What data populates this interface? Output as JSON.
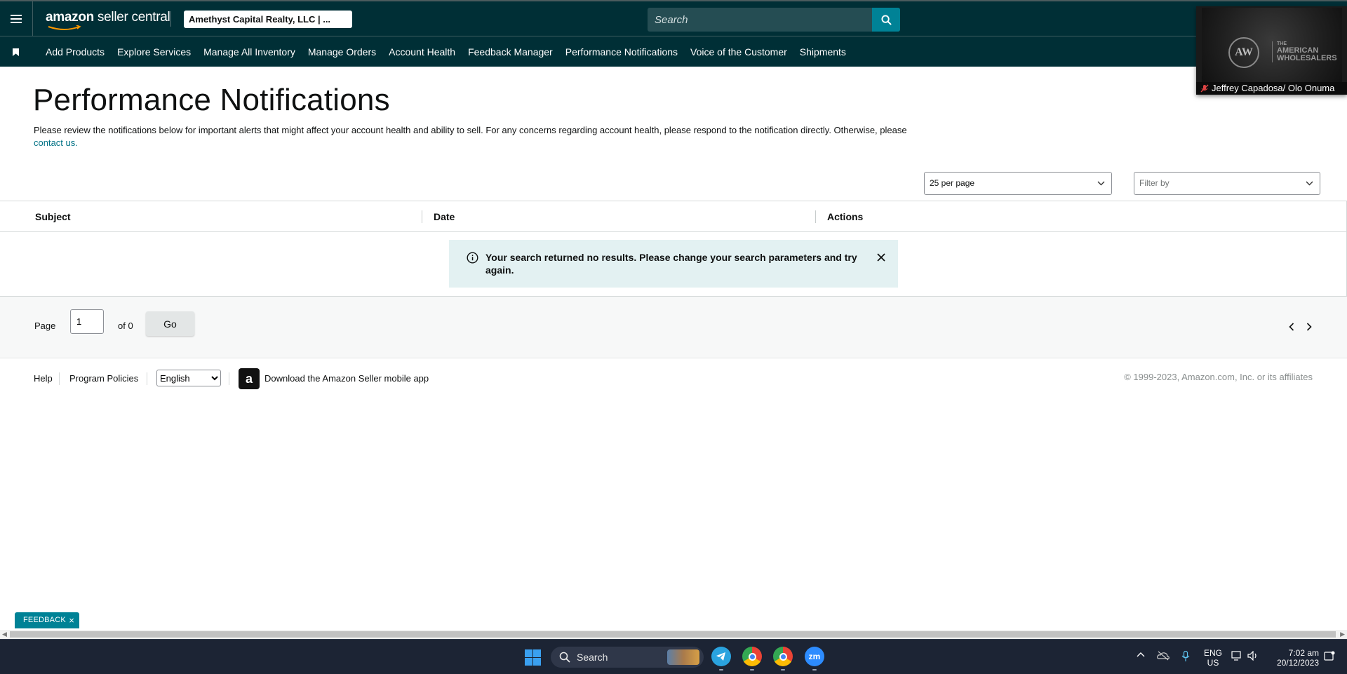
{
  "header": {
    "logo_text_bold": "amazon",
    "logo_text_light": " seller central",
    "account_selector": "Amethyst Capital Realty, LLC | ...",
    "search_placeholder": "Search"
  },
  "nav": {
    "items": [
      {
        "label": "Add Products"
      },
      {
        "label": "Explore Services"
      },
      {
        "label": "Manage All Inventory"
      },
      {
        "label": "Manage Orders"
      },
      {
        "label": "Account Health"
      },
      {
        "label": "Feedback Manager"
      },
      {
        "label": "Performance Notifications"
      },
      {
        "label": "Voice of the Customer"
      },
      {
        "label": "Shipments"
      }
    ]
  },
  "video_overlay": {
    "emblem": "AW",
    "brand_line1": "THE",
    "brand_line2": "AMERICAN",
    "brand_line3": "WHOLESALERS",
    "participant": "Jeffrey Capadosa/ Olo Onuma"
  },
  "page": {
    "title": "Performance Notifications",
    "description": "Please review the notifications below for important alerts that might affect your account health and ability to sell. For any concerns regarding account health, please respond to the notification directly. Otherwise, please ",
    "contact_link": "contact us.",
    "per_page_select": "25 per page",
    "filter_select": "Filter by"
  },
  "table": {
    "columns": [
      "Subject",
      "Date",
      "Actions"
    ],
    "empty_message": "Your search returned no results. Please change your search parameters and try again."
  },
  "pager": {
    "page_label": "Page",
    "page_value": "1",
    "of_label": "of 0",
    "go_label": "Go"
  },
  "footer": {
    "help": "Help",
    "policies": "Program Policies",
    "language": "English",
    "app_icon_letter": "a",
    "app_download": "Download the Amazon Seller mobile app",
    "copyright": "© 1999-2023, Amazon.com, Inc. or its affiliates"
  },
  "feedback": {
    "label": "FEEDBACK",
    "close": "×"
  },
  "taskbar": {
    "search_label": "Search",
    "zoom_label": "zm",
    "lang_line1": "ENG",
    "lang_line2": "US",
    "time": "7:02 am",
    "date": "20/12/2023"
  },
  "colors": {
    "header_bg": "#002f36",
    "accent_teal": "#008296",
    "link": "#007185",
    "alert_bg": "#e3f1f2",
    "taskbar_bg": "#1c2434"
  }
}
